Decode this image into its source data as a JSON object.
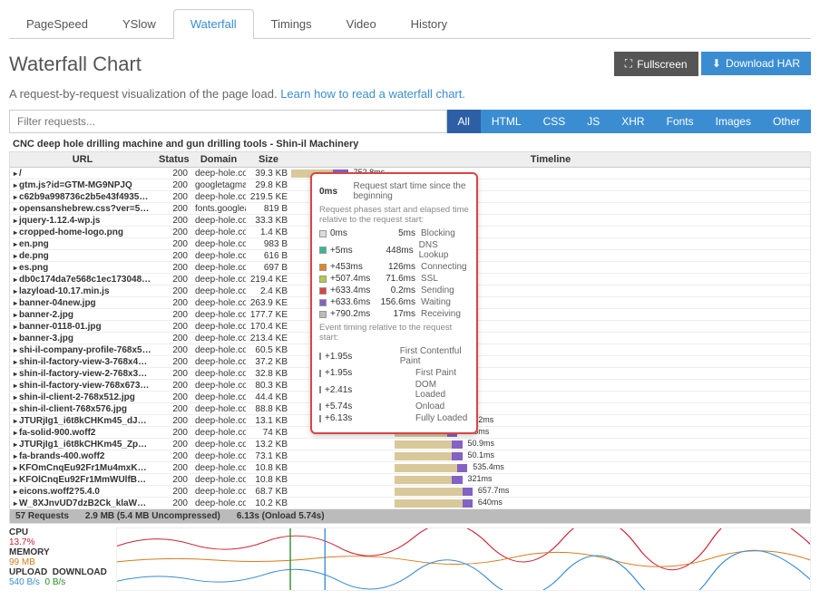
{
  "tabs": [
    "PageSpeed",
    "YSlow",
    "Waterfall",
    "Timings",
    "Video",
    "History"
  ],
  "activeTab": 2,
  "title": "Waterfall Chart",
  "buttons": {
    "fullscreen": "Fullscreen",
    "download": "Download HAR"
  },
  "subtitle": {
    "text": "A request-by-request visualization of the page load.",
    "link": "Learn how to read a waterfall chart"
  },
  "filterPlaceholder": "Filter requests...",
  "filterBtns": [
    "All",
    "HTML",
    "CSS",
    "JS",
    "XHR",
    "Fonts",
    "Images",
    "Other"
  ],
  "caption": "CNC deep hole drilling machine and gun drilling tools - Shin-il Machinery",
  "headers": {
    "url": "URL",
    "status": "Status",
    "domain": "Domain",
    "size": "Size",
    "timeline": "Timeline"
  },
  "firstTime": "752.8ms",
  "rows": [
    {
      "url": "/",
      "status": 200,
      "domain": "deep-hole.com",
      "size": "39.3 KB",
      "start": 0,
      "len": 8,
      "wait": 3,
      "t": ""
    },
    {
      "url": "gtm.js?id=GTM-MG9NPJQ",
      "status": 200,
      "domain": "googletagmanager...",
      "size": "29.8 KB",
      "start": 8,
      "len": 5,
      "wait": 2,
      "t": ""
    },
    {
      "url": "c62b9a998736c2b5e43f4935c1...",
      "status": 200,
      "domain": "deep-hole.com",
      "size": "219.5 KE",
      "start": 8,
      "len": 6,
      "wait": 2,
      "t": ""
    },
    {
      "url": "opensanshebrew.css?ver=5.2.7",
      "status": 200,
      "domain": "fonts.googleapis.com",
      "size": "819 B",
      "start": 8,
      "len": 5,
      "wait": 2,
      "t": ""
    },
    {
      "url": "jquery-1.12.4-wp.js",
      "status": 200,
      "domain": "deep-hole.com",
      "size": "33.3 KB",
      "start": 8,
      "len": 5,
      "wait": 2,
      "t": ""
    },
    {
      "url": "cropped-home-logo.png",
      "status": 200,
      "domain": "deep-hole.com",
      "size": "1.4 KB",
      "start": 8,
      "len": 4,
      "wait": 1,
      "t": ""
    },
    {
      "url": "en.png",
      "status": 200,
      "domain": "deep-hole.com",
      "size": "983 B",
      "start": 8,
      "len": 4,
      "wait": 1,
      "t": ""
    },
    {
      "url": "de.png",
      "status": 200,
      "domain": "deep-hole.com",
      "size": "616 B",
      "start": 8,
      "len": 4,
      "wait": 1,
      "t": ""
    },
    {
      "url": "es.png",
      "status": 200,
      "domain": "deep-hole.com",
      "size": "697 B",
      "start": 8,
      "len": 4,
      "wait": 1,
      "t": ""
    },
    {
      "url": "db0c174da7e568c1ec173048ba...",
      "status": 200,
      "domain": "deep-hole.com",
      "size": "219.4 KE",
      "start": 8,
      "len": 6,
      "wait": 2,
      "t": ""
    },
    {
      "url": "lazyload-10.17.min.js",
      "status": 200,
      "domain": "deep-hole.com",
      "size": "2.4 KB",
      "start": 8,
      "len": 4,
      "wait": 1,
      "t": ""
    },
    {
      "url": "banner-04new.jpg",
      "status": 200,
      "domain": "deep-hole.com",
      "size": "263.9 KE",
      "start": 8,
      "len": 6,
      "wait": 2,
      "t": ""
    },
    {
      "url": "banner-2.jpg",
      "status": 200,
      "domain": "deep-hole.com",
      "size": "177.7 KE",
      "start": 8,
      "len": 6,
      "wait": 2,
      "t": ""
    },
    {
      "url": "banner-0118-01.jpg",
      "status": 200,
      "domain": "deep-hole.com",
      "size": "170.4 KE",
      "start": 8,
      "len": 6,
      "wait": 2,
      "t": ""
    },
    {
      "url": "banner-3.jpg",
      "status": 200,
      "domain": "deep-hole.com",
      "size": "213.4 KE",
      "start": 8,
      "len": 6,
      "wait": 2,
      "t": ""
    },
    {
      "url": "shi-il-company-profile-768x513...",
      "status": 200,
      "domain": "deep-hole.com",
      "size": "60.5 KB",
      "start": 8,
      "len": 5,
      "wait": 2,
      "t": ""
    },
    {
      "url": "shin-il-factory-view-3-768x430...",
      "status": 200,
      "domain": "deep-hole.com",
      "size": "37.2 KB",
      "start": 8,
      "len": 5,
      "wait": 2,
      "t": ""
    },
    {
      "url": "shin-il-factory-view-2-768x329...",
      "status": 200,
      "domain": "deep-hole.com",
      "size": "32.8 KB",
      "start": 8,
      "len": 5,
      "wait": 1,
      "t": ""
    },
    {
      "url": "shin-il-factory-view-768x673.jpg",
      "status": 200,
      "domain": "deep-hole.com",
      "size": "80.3 KB",
      "start": 8,
      "len": 5,
      "wait": 2,
      "t": ""
    },
    {
      "url": "shin-il-client-2-768x512.jpg",
      "status": 200,
      "domain": "deep-hole.com",
      "size": "44.4 KB",
      "start": 8,
      "len": 5,
      "wait": 2,
      "t": ""
    },
    {
      "url": "shin-il-client-768x576.jpg",
      "status": 200,
      "domain": "deep-hole.com",
      "size": "88.8 KB",
      "start": 8,
      "len": 6,
      "wait": 2,
      "t": ""
    },
    {
      "url": "JTURjIg1_i6t8kCHKm45_dJE3...",
      "status": 200,
      "domain": "deep-hole.com",
      "size": "13.1 KB",
      "start": 20,
      "len": 10,
      "wait": 2,
      "t": "496.2ms"
    },
    {
      "url": "fa-solid-900.woff2",
      "status": 200,
      "domain": "deep-hole.com",
      "size": "74 KB",
      "start": 20,
      "len": 10,
      "wait": 2,
      "t": "48.5ms"
    },
    {
      "url": "JTURjIg1_i6t8kCHKm45_ZpC3...",
      "status": 200,
      "domain": "deep-hole.com",
      "size": "13.2 KB",
      "start": 20,
      "len": 11,
      "wait": 2,
      "t": "50.9ms"
    },
    {
      "url": "fa-brands-400.woff2",
      "status": 200,
      "domain": "deep-hole.com",
      "size": "73.1 KB",
      "start": 20,
      "len": 11,
      "wait": 2,
      "t": "50.1ms"
    },
    {
      "url": "KFOmCnqEu92Fr1Mu4mxKKT...",
      "status": 200,
      "domain": "deep-hole.com",
      "size": "10.8 KB",
      "start": 20,
      "len": 12,
      "wait": 2,
      "t": "535.4ms"
    },
    {
      "url": "KFOlCnqEu92Fr1MmWUlfBBc...",
      "status": 200,
      "domain": "deep-hole.com",
      "size": "10.8 KB",
      "start": 20,
      "len": 11,
      "wait": 2,
      "t": "321ms"
    },
    {
      "url": "eicons.woff2?5.4.0",
      "status": 200,
      "domain": "deep-hole.com",
      "size": "68.7 KB",
      "start": 20,
      "len": 13,
      "wait": 2,
      "t": "657.7ms"
    },
    {
      "url": "W_8XJnvUD7dzB2Ck_klaWUM...",
      "status": 200,
      "domain": "deep-hole.com",
      "size": "10.2 KB",
      "start": 20,
      "len": 13,
      "wait": 2,
      "t": "640ms"
    }
  ],
  "summary": {
    "requests": "57 Requests",
    "size": "2.9 MB (5.4 MB Uncompressed)",
    "time": "6.13s (Onload 5.74s)"
  },
  "tooltip": {
    "t0": "0ms",
    "t0label": "Request start time since the beginning",
    "phasesHead": "Request phases start and elapsed time relative to the request start:",
    "phases": [
      {
        "c": "#ddd",
        "t1": "0ms",
        "t2": "5ms",
        "l": "Blocking"
      },
      {
        "c": "#32b89a",
        "t1": "+5ms",
        "t2": "448ms",
        "l": "DNS Lookup"
      },
      {
        "c": "#e8851c",
        "t1": "+453ms",
        "t2": "126ms",
        "l": "Connecting"
      },
      {
        "c": "#b4c940",
        "t1": "+507.4ms",
        "t2": "71.6ms",
        "l": "SSL"
      },
      {
        "c": "#d94545",
        "t1": "+633.4ms",
        "t2": "0.2ms",
        "l": "Sending"
      },
      {
        "c": "#8262c4",
        "t1": "+633.6ms",
        "t2": "156.6ms",
        "l": "Waiting"
      },
      {
        "c": "#bbb",
        "t1": "+790.2ms",
        "t2": "17ms",
        "l": "Receiving"
      }
    ],
    "eventsHead": "Event timing relative to the request start:",
    "events": [
      {
        "t": "+1.95s",
        "l": "First Contentful Paint"
      },
      {
        "t": "+1.95s",
        "l": "First Paint"
      },
      {
        "t": "+2.41s",
        "l": "DOM Loaded"
      },
      {
        "t": "+5.74s",
        "l": "Onload"
      },
      {
        "t": "+6.13s",
        "l": "Fully Loaded"
      }
    ]
  },
  "metrics": {
    "cpu": {
      "label": "CPU",
      "value": "13.7%"
    },
    "memory": {
      "label": "MEMORY",
      "value": "99 MB"
    },
    "upload": {
      "label": "UPLOAD",
      "value": "540 B/s"
    },
    "download": {
      "label": "DOWNLOAD",
      "value": "0 B/s"
    }
  }
}
